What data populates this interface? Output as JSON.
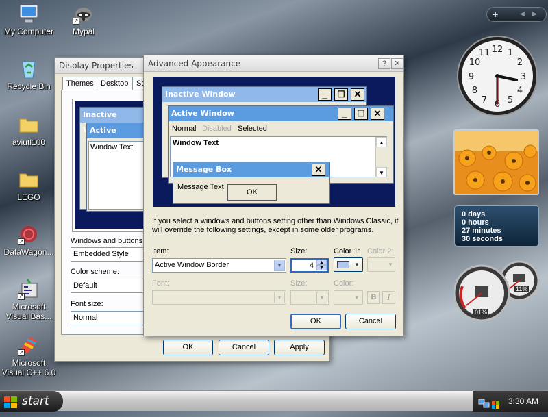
{
  "desktop": {
    "icons": [
      {
        "label": "My Computer",
        "icon": "computer-icon"
      },
      {
        "label": "Mypal",
        "icon": "raccoon-icon"
      },
      {
        "label": "Recycle Bin",
        "icon": "recycle-bin-icon"
      },
      {
        "label": "aviutl100",
        "icon": "folder-icon"
      },
      {
        "label": "LEGO",
        "icon": "folder-icon"
      },
      {
        "label": "DataWagon...",
        "icon": "red-circle-icon"
      },
      {
        "label": "Microsoft Visual Bas...",
        "icon": "visual-basic-icon"
      },
      {
        "label": "Microsoft Visual C++ 6.0",
        "icon": "visual-cpp-icon"
      }
    ]
  },
  "display_properties": {
    "title": "Display Properties",
    "tabs": [
      "Themes",
      "Desktop",
      "Sc"
    ],
    "preview": {
      "inactive_title": "Inactive Window",
      "active_title": "Active Window",
      "window_text": "Window Text"
    },
    "windows_and_buttons_label": "Windows and buttons:",
    "windows_and_buttons_value": "Embedded Style",
    "color_scheme_label": "Color scheme:",
    "color_scheme_value": "Default",
    "font_size_label": "Font size:",
    "font_size_value": "Normal",
    "ok": "OK",
    "cancel": "Cancel",
    "apply": "Apply"
  },
  "advanced_appearance": {
    "title": "Advanced Appearance",
    "preview": {
      "inactive_title": "Inactive Window",
      "active_title": "Active Window",
      "menu_normal": "Normal",
      "menu_disabled": "Disabled",
      "menu_selected": "Selected",
      "window_text": "Window Text",
      "message_box_title": "Message Box",
      "message_text": "Message Text",
      "message_ok": "OK"
    },
    "info_text": "If you select a windows and buttons setting other than Windows Classic, it will override the following settings, except in some older programs.",
    "item_label": "Item:",
    "item_value": "Active Window Border",
    "size_label": "Size:",
    "size_value": "4",
    "color1_label": "Color 1:",
    "color2_label": "Color 2:",
    "font_label": "Font:",
    "font_size_label": "Size:",
    "font_color_label": "Color:",
    "bold_label": "B",
    "italic_label": "I",
    "ok": "OK",
    "cancel": "Cancel"
  },
  "gadgets": {
    "clock_icon": "analog-clock-icon",
    "photo_icon": "flower-photo-icon",
    "countdown": [
      "0 days",
      "0 hours",
      "27 minutes",
      "30 seconds"
    ],
    "cpu_percent": "01%",
    "memory_percent": "11%"
  },
  "taskbar": {
    "start_label": "start",
    "time": "3:30 AM"
  },
  "colors": {
    "preview_bg": "#0a1a5c",
    "active_title": "#5b9be0",
    "inactive_title": "#8fb8e8",
    "selection_border": "#316ac5"
  }
}
